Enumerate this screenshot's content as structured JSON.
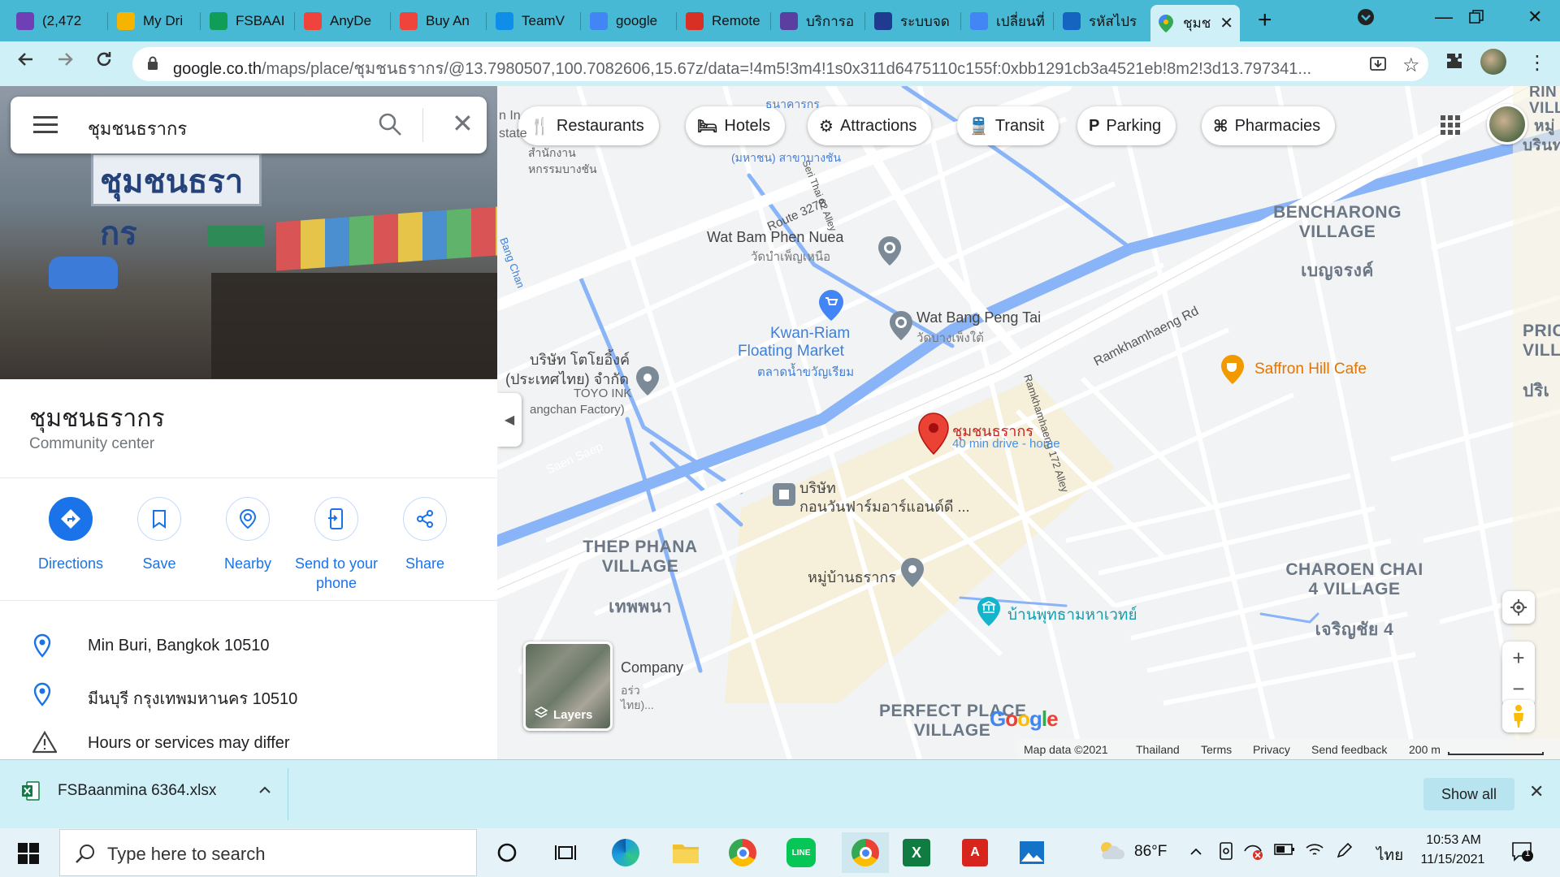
{
  "browser": {
    "tabs": [
      {
        "label": "(2,472",
        "icon": "mail-icon",
        "color": "#6f3fb6"
      },
      {
        "label": "My Dri",
        "icon": "drive-icon",
        "color": "#f4b400"
      },
      {
        "label": "FSBAAI",
        "icon": "sheets-icon",
        "color": "#0f9d58"
      },
      {
        "label": "AnyDe",
        "icon": "anydesk-icon",
        "color": "#ef443b"
      },
      {
        "label": "Buy An",
        "icon": "anydesk-icon",
        "color": "#ef443b"
      },
      {
        "label": "TeamV",
        "icon": "teamviewer-icon",
        "color": "#0e8ee9"
      },
      {
        "label": "google",
        "icon": "google-icon",
        "color": "#4285f4"
      },
      {
        "label": "Remote",
        "icon": "remote-icon",
        "color": "#d93025"
      },
      {
        "label": "บริการอ",
        "icon": "service-icon",
        "color": "#5b3fa0"
      },
      {
        "label": "ระบบจด",
        "icon": "psd-icon",
        "color": "#1f3b8f"
      },
      {
        "label": "เปลี่ยนที่",
        "icon": "google-icon",
        "color": "#4285f4"
      },
      {
        "label": "รหัสไปร",
        "icon": "n-icon",
        "color": "#1565c0"
      }
    ],
    "active_tab": {
      "label": "ชุมช",
      "icon": "maps-pin-icon"
    },
    "url_host": "google.co.th",
    "url_path": "/maps/place/ชุมชนธรากร/@13.7980507,100.7082606,15.67z/data=!4m5!3m4!1s0x311d6475110c155f:0xbb1291cb3a4521eb!8m2!3d13.797341..."
  },
  "search": {
    "query": "ชุมชนธรากร"
  },
  "place": {
    "title": "ชุมชนธรากร",
    "category": "Community center",
    "actions": [
      {
        "label": "Directions",
        "icon": "directions-icon"
      },
      {
        "label": "Save",
        "icon": "bookmark-icon"
      },
      {
        "label": "Nearby",
        "icon": "nearby-icon"
      },
      {
        "label": "Send to your phone",
        "icon": "send-to-phone-icon"
      },
      {
        "label": "Share",
        "icon": "share-icon"
      }
    ],
    "info": [
      {
        "text": "Min Buri, Bangkok 10510",
        "icon": "location-pin-icon"
      },
      {
        "text": "มีนบุรี กรุงเทพมหานคร 10510",
        "icon": "location-pin-icon"
      },
      {
        "text": "Hours or services may differ",
        "icon": "warning-icon"
      }
    ]
  },
  "map": {
    "chips": [
      {
        "label": "Restaurants",
        "icon": "restaurant-icon"
      },
      {
        "label": "Hotels",
        "icon": "hotel-icon"
      },
      {
        "label": "Attractions",
        "icon": "attractions-icon"
      },
      {
        "label": "Transit",
        "icon": "transit-icon"
      },
      {
        "label": "Parking",
        "icon": "parking-icon"
      },
      {
        "label": "Pharmacies",
        "icon": "pharmacy-icon"
      }
    ],
    "labels": {
      "route": "Route 3278",
      "wat_bam": "Wat Bam Phen Nuea",
      "wat_bam_th": "วัดบำเพ็ญเหนือ",
      "kwan1": "Kwan-Riam",
      "kwan2": "Floating Market",
      "kwan_th": "ตลาดน้ำขวัญเรียม",
      "wat_bang": "Wat Bang Peng Tai",
      "wat_bang_th": "วัดบางเพ็งใต้",
      "toyo1": "บริษัท โตโยอิ้งค์",
      "toyo2": "(ประเทศไทย) จำกัด",
      "toyo3": "TOYO INK",
      "toyo4": "angchan Factory)",
      "ramkhamhaeng": "Ramkhamhaeng Rd",
      "saffron": "Saffron Hill Cafe",
      "bencharong1": "BENCHARONG",
      "bencharong2": "VILLAGE",
      "bencharong_th": "เบญจรงค์",
      "pin_title": "ชุมชนธรากร",
      "pin_sub": "40 min drive - home",
      "company1": "บริษัท",
      "company2": "กอนวันฟาร์มอาร์แอนด์ดี ...",
      "thep1": "THEP PHANA",
      "thep2": "VILLAGE",
      "thep_th": "เทพพนา",
      "moo": "หมู่บ้านธรากร",
      "baan": "บ้านพุทธามหาเวทย์",
      "charoen1": "CHAROEN CHAI",
      "charoen2": "4 VILLAGE",
      "charoen_th": "เจริญชัย 4",
      "perfect1": "PERFECT PLACE",
      "perfect2": "VILLAGE",
      "company_en": "Company",
      "saen": "Saen Saep",
      "bangchan": "Bang Chan",
      "ramk172": "Ramkhamhaeng 172 Alley",
      "seri": "Seri Thai 62 Alley",
      "top_th": "ธนาคารกร",
      "top_th2": "(มหาชน) สาขาบางชัน",
      "tl1": "n In",
      "tl2": "state",
      "tl3": "สำนักงาน",
      "tl4": "หกรรมบางชัน",
      "pric1": "PRIC",
      "pric2": "VILL",
      "pric3": "ปริเ",
      "rin": "RIN T",
      "vill": "VILLA",
      "mu": "หมู่",
      "rin_th": "บรินทร",
      "ri2": "อร่ว",
      "ri3": "ไทย)..."
    },
    "layers_label": "Layers",
    "footer": {
      "mapdata": "Map data ©2021",
      "country": "Thailand",
      "terms": "Terms",
      "privacy": "Privacy",
      "feedback": "Send feedback",
      "scale": "200 m"
    },
    "google_logo": "Google"
  },
  "download": {
    "file": "FSBaanmina 6364.xlsx",
    "show_all": "Show all"
  },
  "taskbar": {
    "search_placeholder": "Type here to search",
    "weather": "86°F",
    "lang": "ไทย",
    "time": "10:53 AM",
    "date": "11/15/2021",
    "notif_count": "1"
  }
}
